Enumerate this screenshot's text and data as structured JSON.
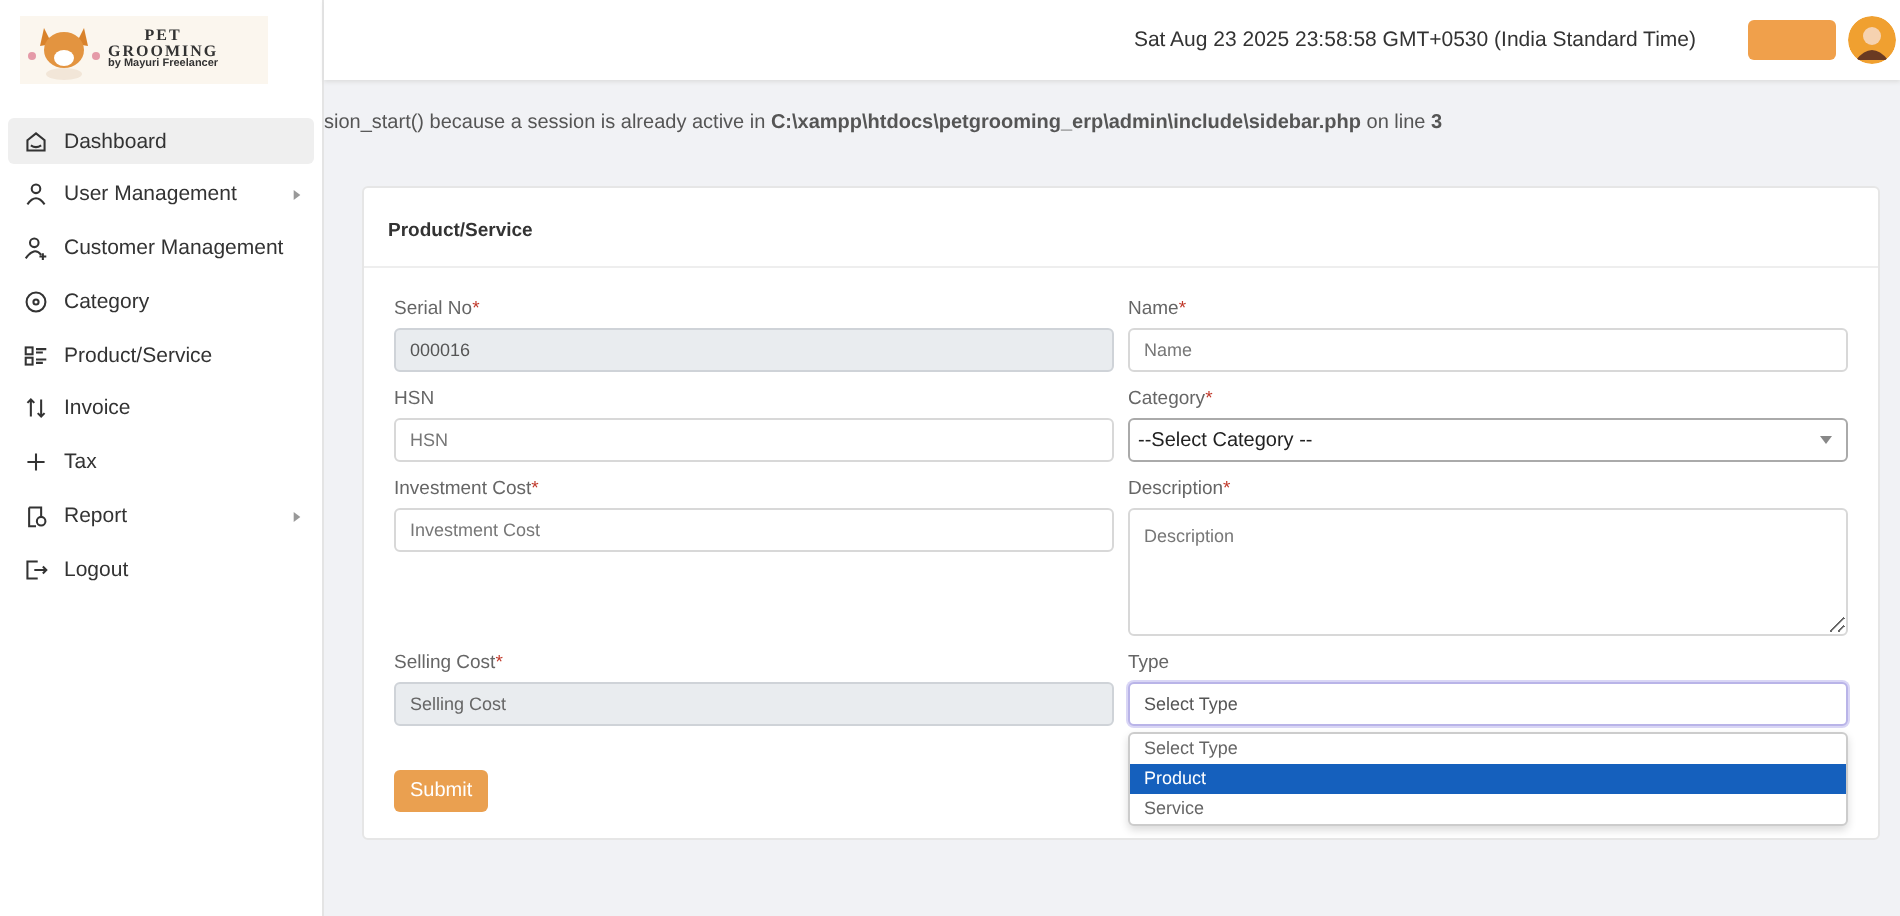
{
  "logo": {
    "title_top": "PET",
    "title_main": "GROOMING",
    "tagline": "by Mayuri Freelancer"
  },
  "header": {
    "datetime": "Sat Aug 23 2025 23:58:58 GMT+0530 (India Standard Time)"
  },
  "sidebar": {
    "items": [
      {
        "label": "Dashboard",
        "selected": true,
        "has_submenu": false
      },
      {
        "label": "User Management",
        "selected": false,
        "has_submenu": true
      },
      {
        "label": "Customer Management",
        "selected": false,
        "has_submenu": false
      },
      {
        "label": "Category",
        "selected": false,
        "has_submenu": false
      },
      {
        "label": "Product/Service",
        "selected": false,
        "has_submenu": false
      },
      {
        "label": "Invoice",
        "selected": false,
        "has_submenu": false
      },
      {
        "label": "Tax",
        "selected": false,
        "has_submenu": false
      },
      {
        "label": "Report",
        "selected": false,
        "has_submenu": true
      },
      {
        "label": "Logout",
        "selected": false,
        "has_submenu": false
      }
    ]
  },
  "notice": "sion_start() because a session is already active in **C:\\xampp\\htdocs\\petgrooming_erp\\admin\\include\\sidebar.php** on line **3**",
  "form": {
    "title": "Product/Service",
    "fields": [
      {
        "kind": "input",
        "label": "Serial No",
        "required": "*",
        "value": "000016",
        "disabled": true
      },
      {
        "kind": "input",
        "label": "Name",
        "required": "*",
        "placeholder": "Name",
        "disabled": false
      },
      {
        "kind": "input",
        "label": "HSN",
        "placeholder": "HSN",
        "disabled": false
      },
      {
        "kind": "select",
        "label": "Category",
        "required": "*",
        "value": "--Select Category --"
      },
      {
        "kind": "input",
        "label": "Investment Cost",
        "required": "*",
        "placeholder": "Investment Cost",
        "disabled": false
      },
      {
        "kind": "textarea",
        "label": "Description",
        "required": "*",
        "placeholder": "Description"
      },
      {
        "kind": "input",
        "label": "Selling Cost",
        "required": "*",
        "placeholder": "Selling Cost",
        "disabled": true
      },
      {
        "kind": "dropdown",
        "label": "Type",
        "value": "Select Type",
        "expanded": true,
        "options": [
          {
            "label": "Select Type",
            "highlighted": false
          },
          {
            "label": "Product",
            "highlighted": true
          },
          {
            "label": "Service",
            "highlighted": false
          }
        ]
      }
    ],
    "submit": "Submit"
  }
}
